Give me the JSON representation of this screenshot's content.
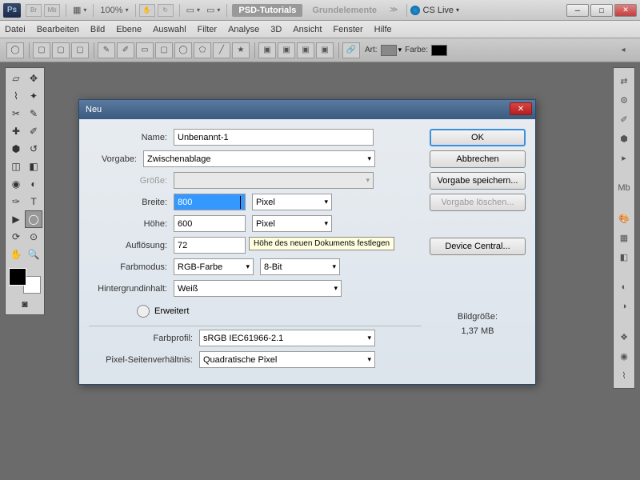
{
  "app": {
    "logo": "Ps",
    "zoom": "100%"
  },
  "workspaces": {
    "active": "PSD-Tutorials",
    "inactive": "Grundelemente"
  },
  "cslive": "CS Live",
  "menu": [
    "Datei",
    "Bearbeiten",
    "Bild",
    "Ebene",
    "Auswahl",
    "Filter",
    "Analyse",
    "3D",
    "Ansicht",
    "Fenster",
    "Hilfe"
  ],
  "optbar": {
    "art": "Art:",
    "farbe": "Farbe:",
    "farbe_color": "#000000"
  },
  "dialog": {
    "title": "Neu",
    "labels": {
      "name": "Name:",
      "vorgabe": "Vorgabe:",
      "groesse": "Größe:",
      "breite": "Breite:",
      "hoehe": "Höhe:",
      "aufloesung": "Auflösung:",
      "farbmodus": "Farbmodus:",
      "hintergrund": "Hintergrundinhalt:",
      "erweitert": "Erweitert",
      "farbprofil": "Farbprofil:",
      "pixelverhaeltnis": "Pixel-Seitenverhältnis:",
      "bildgroesse": "Bildgröße:"
    },
    "values": {
      "name": "Unbenannt-1",
      "vorgabe": "Zwischenablage",
      "groesse": "",
      "breite": "800",
      "breite_unit": "Pixel",
      "hoehe": "600",
      "hoehe_unit": "Pixel",
      "aufloesung": "72",
      "farbmodus": "RGB-Farbe",
      "farbtiefe": "8-Bit",
      "hintergrund": "Weiß",
      "farbprofil": "sRGB IEC61966-2.1",
      "pixelverhaeltnis": "Quadratische Pixel",
      "bildgroesse_val": "1,37 MB"
    },
    "buttons": {
      "ok": "OK",
      "abbrechen": "Abbrechen",
      "vorgabe_speichern": "Vorgabe speichern...",
      "vorgabe_loeschen": "Vorgabe löschen...",
      "device_central": "Device Central..."
    },
    "tooltip": "Höhe des neuen Dokuments festlegen"
  }
}
